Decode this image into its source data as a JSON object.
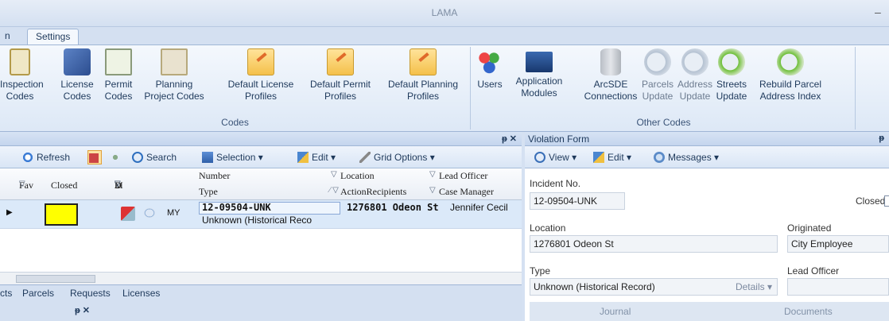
{
  "window": {
    "title": "LAMA",
    "minimize_glyph": "–"
  },
  "tabs": [
    {
      "label": "n"
    },
    {
      "label": "Settings"
    }
  ],
  "ribbon": {
    "codes_group": {
      "label": "Codes",
      "buttons": [
        {
          "label": "Inspection\nCodes",
          "icon": "clipboard-icon"
        },
        {
          "label": "License\nCodes",
          "icon": "id-card-icon"
        },
        {
          "label": "Permit\nCodes",
          "icon": "certificate-icon"
        },
        {
          "label": "Planning\nProject Codes",
          "icon": "blueprint-icon"
        },
        {
          "label": "Default License\nProfiles",
          "icon": "folder-pencil-icon"
        },
        {
          "label": "Default Permit\nProfiles",
          "icon": "folder-pencil-icon"
        },
        {
          "label": "Default Planning\nProfiles",
          "icon": "folder-pencil-icon"
        }
      ]
    },
    "other_group": {
      "label": "Other Codes",
      "buttons": [
        {
          "label": "Users",
          "icon": "users-icon"
        },
        {
          "label": "Application\nModules",
          "icon": "screen-icon"
        },
        {
          "label": "ArcSDE\nConnections",
          "icon": "database-icon"
        },
        {
          "label": "Parcels\nUpdate",
          "icon": "globe-refresh-icon"
        },
        {
          "label": "Address\nUpdate",
          "icon": "globe-refresh-icon"
        },
        {
          "label": "Streets\nUpdate",
          "icon": "globe-refresh-green-icon"
        },
        {
          "label": "Rebuild Parcel\nAddress Index",
          "icon": "globe-rebuild-icon"
        }
      ]
    }
  },
  "left_pane": {
    "pin_label": "ᵽ ✕",
    "toolbar": {
      "refresh": "Refresh",
      "search": "Search",
      "selection": "Selection ▾",
      "edit": "Edit ▾",
      "grid_options": "Grid Options ▾"
    },
    "grid": {
      "headers": {
        "fav": "Fav",
        "closed": "Closed",
        "sigma": "Σ",
        "m": "M",
        "d": "D",
        "number": "Number",
        "type": "Type",
        "location": "Location",
        "action_recipients": "ActionRecipients",
        "lead_officer": "Lead Officer",
        "case_manager": "Case Manager"
      },
      "row": {
        "my": "MY",
        "number": "12-09504-UNK",
        "type": "Unknown (Historical Reco",
        "location": "1276801 Odeon St",
        "lead_officer": "Jennifer Cecil"
      }
    },
    "bottom_tabs": [
      "cts",
      "Parcels",
      "Requests",
      "Licenses"
    ],
    "bottom_pin": "ᵽ ✕"
  },
  "right_pane": {
    "title": "Violation Form",
    "pin_label": "ᵽ",
    "toolbar": {
      "view": "View ▾",
      "edit": "Edit ▾",
      "messages": "Messages ▾"
    },
    "form": {
      "incident_label": "Incident No.",
      "incident_value": "12-09504-UNK",
      "closed_label": "Closed",
      "location_label": "Location",
      "location_value": "1276801 Odeon St",
      "originated_label": "Originated",
      "originated_value": "City Employee",
      "type_label": "Type",
      "type_value": "Unknown (Historical Record)",
      "details_label": "Details ▾",
      "lead_officer_label": "Lead Officer",
      "lead_officer_value": ""
    },
    "subtabs": [
      "Journal",
      "Documents"
    ]
  }
}
